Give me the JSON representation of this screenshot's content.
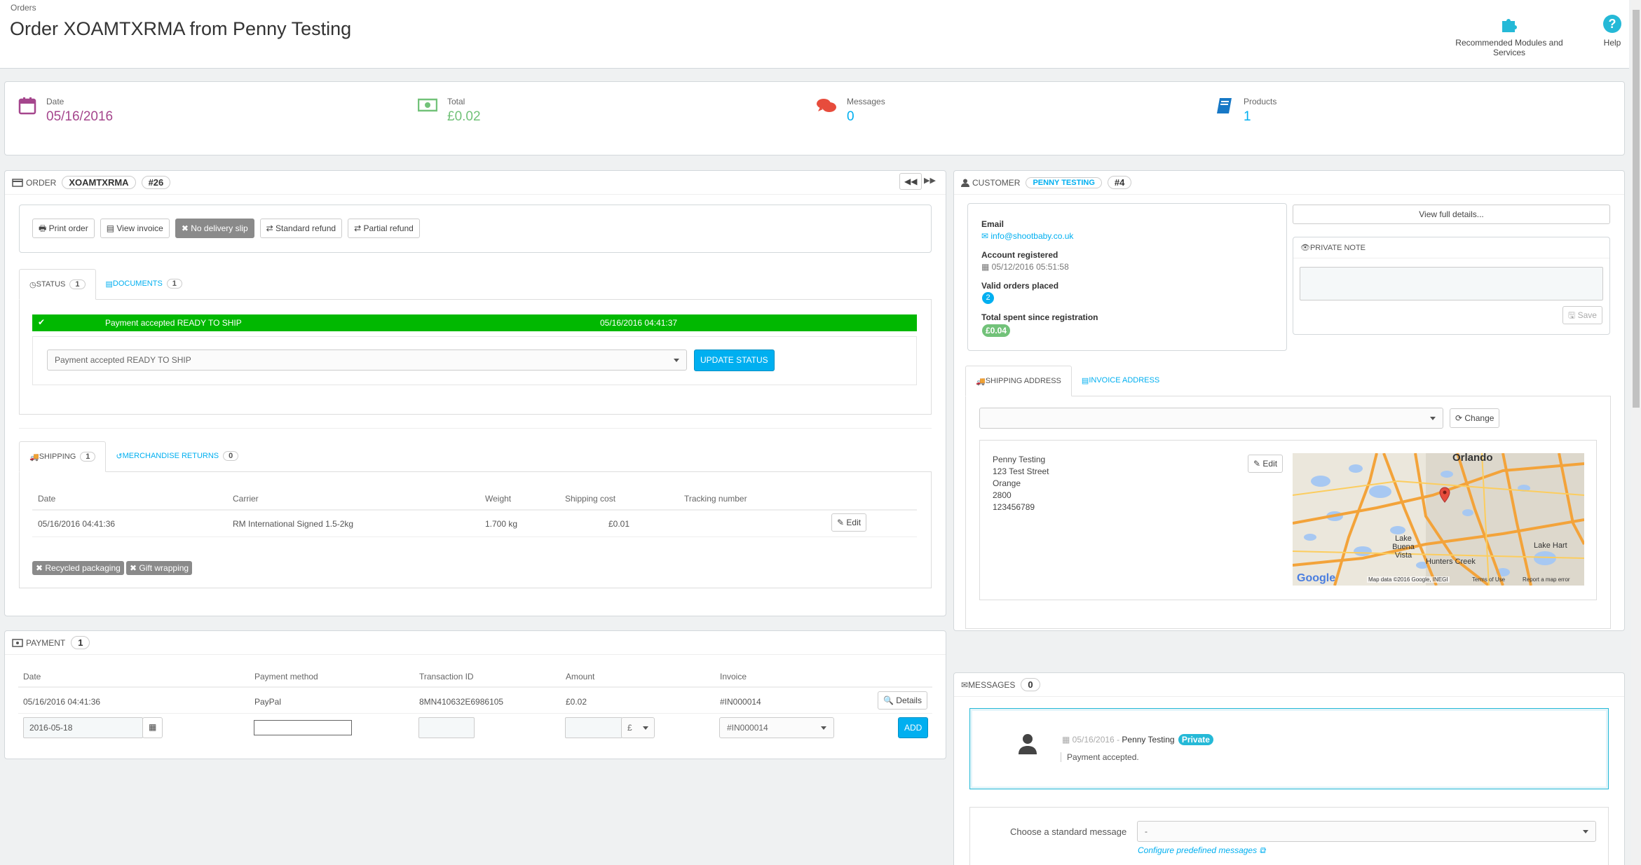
{
  "header": {
    "breadcrumb": "Orders",
    "title": "Order XOAMTXRMA from Penny Testing",
    "recommended_label": "Recommended Modules and Services",
    "help_label": "Help"
  },
  "kpis": [
    {
      "label": "Date",
      "value": "05/16/2016",
      "icon": "calendar-icon",
      "color": "#a5468d"
    },
    {
      "label": "Total",
      "value": "£0.02",
      "icon": "money-icon",
      "color": "#72c279"
    },
    {
      "label": "Messages",
      "value": "0",
      "icon": "comments-icon",
      "color": "#00aff0"
    },
    {
      "label": "Products",
      "value": "1",
      "icon": "book-icon",
      "color": "#00aff0"
    }
  ],
  "order": {
    "heading": "ORDER",
    "reference": "XOAMTXRMA",
    "id": "#26",
    "actions": {
      "print": "Print order",
      "invoice": "View invoice",
      "no_delivery": "No delivery slip",
      "standard_refund": "Standard refund",
      "partial_refund": "Partial refund"
    },
    "tabs": {
      "status": "STATUS",
      "status_count": "1",
      "documents": "DOCUMENTS",
      "documents_count": "1"
    },
    "status_row": {
      "label": "Payment accepted READY TO SHIP",
      "date": "05/16/2016 04:41:37"
    },
    "status_select": "Payment accepted READY TO SHIP",
    "update_status": "UPDATE STATUS",
    "ship_tabs": {
      "shipping": "SHIPPING",
      "shipping_count": "1",
      "returns": "MERCHANDISE RETURNS",
      "returns_count": "0"
    },
    "shipping_table": {
      "headers": [
        "Date",
        "Carrier",
        "Weight",
        "Shipping cost",
        "Tracking number"
      ],
      "row": [
        "05/16/2016 04:41:36",
        "RM International Signed 1.5-2kg",
        "1.700 kg",
        "£0.01",
        ""
      ],
      "edit": "Edit"
    },
    "tags": {
      "recycled": "Recycled packaging",
      "gift": "Gift wrapping"
    }
  },
  "payment": {
    "heading": "PAYMENT",
    "count": "1",
    "headers": [
      "Date",
      "Payment method",
      "Transaction ID",
      "Amount",
      "Invoice"
    ],
    "row": [
      "05/16/2016 04:41:36",
      "PayPal",
      "8MN410632E6986105",
      "£0.02",
      "#IN000014"
    ],
    "details": "Details",
    "new_date": "2016-05-18",
    "currency": "£",
    "invoice_select": "#IN000014",
    "add": "ADD"
  },
  "customer": {
    "heading": "CUSTOMER",
    "name": "PENNY TESTING",
    "id": "#4",
    "email_label": "Email",
    "email": "info@shootbaby.co.uk",
    "registered_label": "Account registered",
    "registered": "05/12/2016 05:51:58",
    "orders_label": "Valid orders placed",
    "orders": "2",
    "spent_label": "Total spent since registration",
    "spent": "£0.04",
    "view_details": "View full details...",
    "private_note": "PRIVATE NOTE",
    "save": "Save",
    "addr_tabs": {
      "shipping": "SHIPPING ADDRESS",
      "invoice": "INVOICE ADDRESS"
    },
    "change": "Change",
    "edit": "Edit",
    "address": [
      "Penny Testing",
      "123 Test Street",
      "Orange",
      "2800",
      "123456789"
    ],
    "map": {
      "city": "Orlando",
      "lake_buena_vista": "Lake Buena Vista",
      "lake_hart": "Lake Hart",
      "hunters_creek": "Hunters Creek",
      "google": "Google",
      "map_data": "Map data ©2016 Google, INEGI",
      "terms": "Terms of Use",
      "report": "Report a map error"
    }
  },
  "messages": {
    "heading": "MESSAGES",
    "count": "0",
    "date": "05/16/2016",
    "author": "Penny Testing",
    "private": "Private",
    "text": "Payment accepted.",
    "choose_label": "Choose a standard message",
    "choose_value": "-",
    "configure": "Configure predefined messages"
  }
}
